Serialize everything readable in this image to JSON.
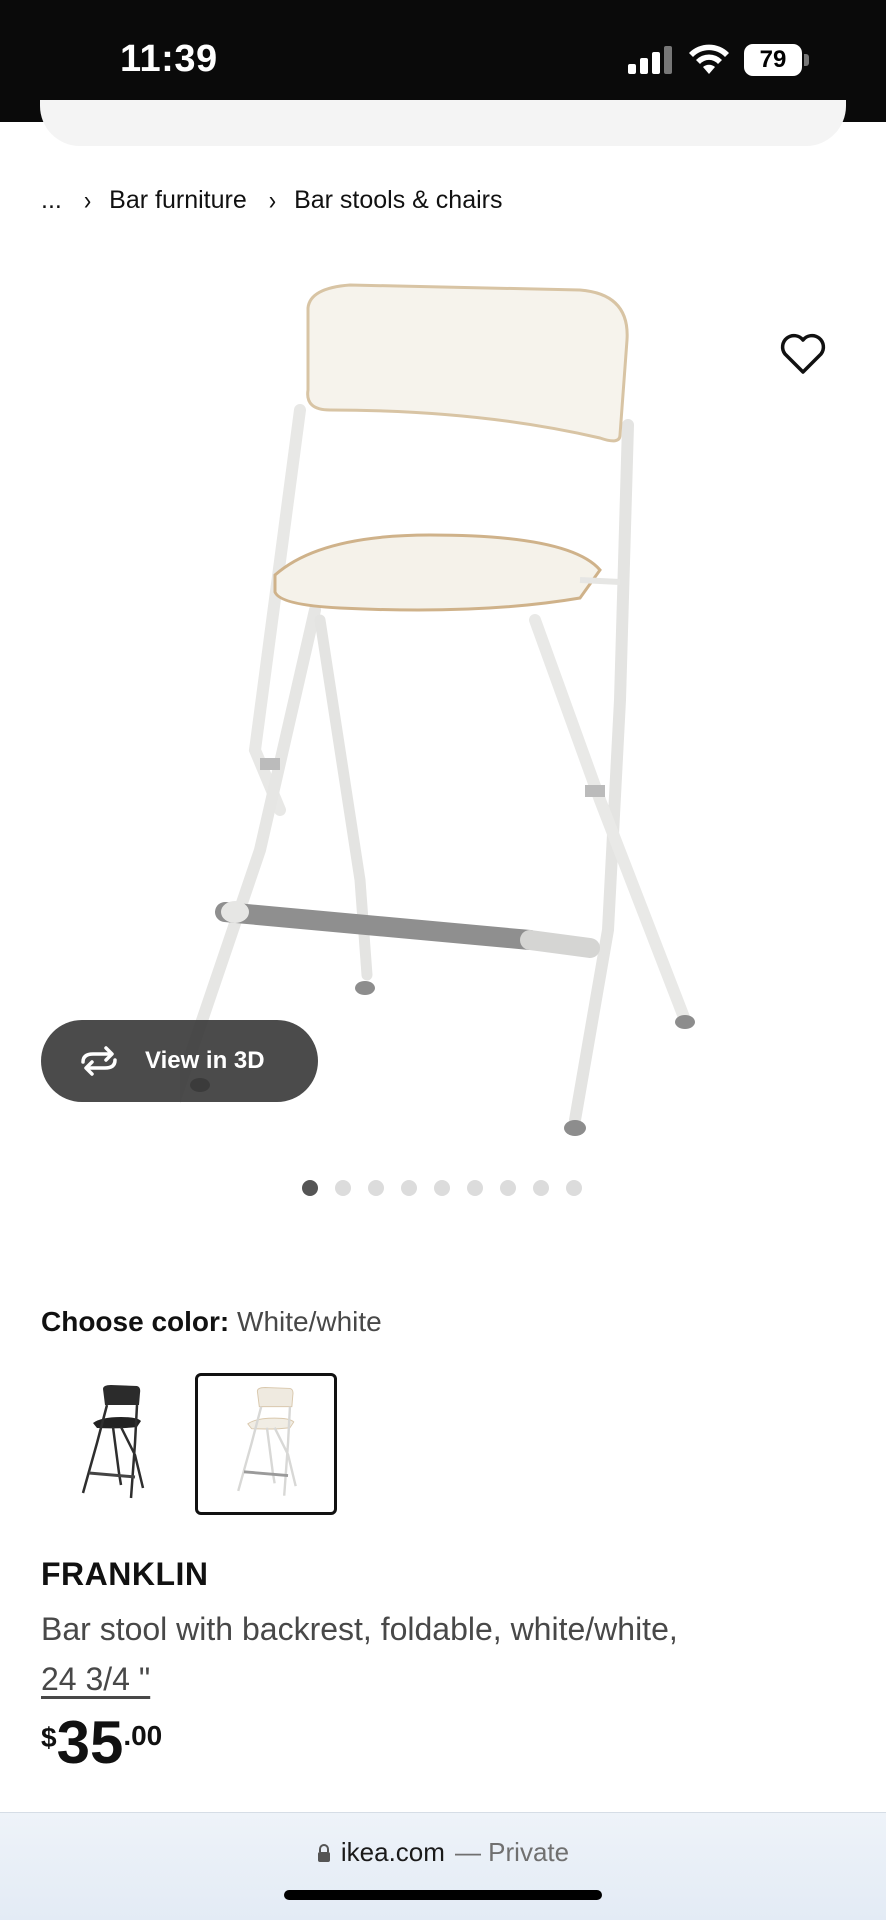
{
  "status_bar": {
    "time": "11:39",
    "battery": "79"
  },
  "breadcrumb": {
    "items": [
      "...",
      "Bar furniture",
      "Bar stools & chairs"
    ]
  },
  "gallery": {
    "view_3d_label": "View in 3D",
    "image_count": 9,
    "active_index": 0
  },
  "color": {
    "label": "Choose color:",
    "value": "White/white",
    "options": [
      "black",
      "white"
    ],
    "selected_index": 1
  },
  "product": {
    "name": "FRANKLIN",
    "description": "Bar stool with backrest, foldable, white/white,",
    "size": "24 3/4 \"",
    "price": {
      "currency": "$",
      "integer": "35",
      "decimal": ".00"
    }
  },
  "browser": {
    "url": "ikea.com",
    "mode": "— Private"
  },
  "colors": {
    "status_bg": "#0a0a0a",
    "view3d_bg": "#3c3c3c",
    "dot_active": "#555555",
    "dot_inactive": "#dcdcdc"
  }
}
